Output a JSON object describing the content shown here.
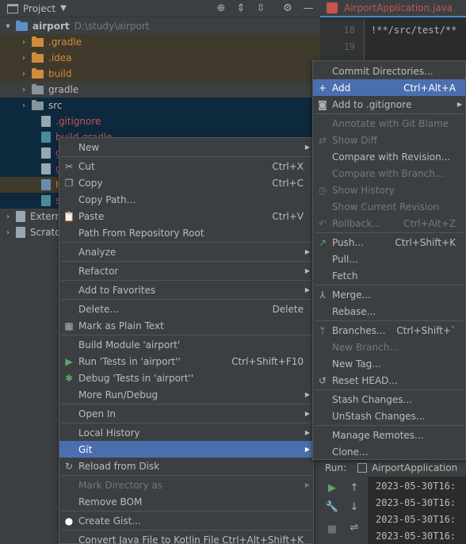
{
  "project": {
    "title": "Project",
    "tree": [
      {
        "label": "airport",
        "path": "D:\\study\\airport",
        "icon": "folder-blue-icon",
        "bold": true
      },
      {
        "label": ".gradle",
        "icon": "folder-orange-icon",
        "color": "#d18c3b"
      },
      {
        "label": ".idea",
        "icon": "folder-orange-icon",
        "color": "#d18c3b"
      },
      {
        "label": "build",
        "icon": "folder-orange-icon",
        "color": "#d18c3b"
      },
      {
        "label": "gradle",
        "icon": "folder-gray-icon",
        "color": "#bbbbbb"
      },
      {
        "label": "src",
        "icon": "folder-gray-icon",
        "color": "#bbbbbb"
      },
      {
        "label": ".gitignore",
        "icon": "gitignore-file-icon",
        "color": "#c75450"
      },
      {
        "label": "build.gradle",
        "icon": "gradle-file-icon",
        "color": "#c75450"
      },
      {
        "label": "gra",
        "icon": "terminal-file-icon",
        "color": "#c75450"
      },
      {
        "label": "gra",
        "icon": "text-file-icon",
        "color": "#c75450"
      },
      {
        "label": "HE",
        "icon": "markdown-file-icon",
        "color": "#d18c3b"
      },
      {
        "label": "set",
        "icon": "gradle-file-icon",
        "color": "#c75450"
      },
      {
        "label": "Extern",
        "icon": "library-icon",
        "color": "#bbbbbb"
      },
      {
        "label": "Scrato",
        "icon": "scratch-icon",
        "color": "#bbbbbb"
      }
    ]
  },
  "editor": {
    "tab_label": "AirportApplication.java",
    "lines": [
      {
        "no": "18",
        "text": "!**/src/test/**"
      },
      {
        "no": "19",
        "text": ""
      }
    ]
  },
  "run": {
    "title": "Run:",
    "tab": "AirportApplication",
    "log": [
      "2023-05-30T16:",
      "2023-05-30T16:",
      "2023-05-30T16:",
      "2023-05-30T16:"
    ]
  },
  "main_menu": {
    "items": [
      {
        "label": "New",
        "sub": true
      },
      {
        "sep": true
      },
      {
        "label": "Cut",
        "shortcut": "Ctrl+X",
        "icon": "cut-icon"
      },
      {
        "label": "Copy",
        "shortcut": "Ctrl+C",
        "icon": "copy-icon"
      },
      {
        "label": "Copy Path..."
      },
      {
        "label": "Paste",
        "shortcut": "Ctrl+V",
        "icon": "paste-icon"
      },
      {
        "label": "Path From Repository Root"
      },
      {
        "sep": true
      },
      {
        "label": "Analyze",
        "sub": true
      },
      {
        "sep": true
      },
      {
        "label": "Refactor",
        "sub": true
      },
      {
        "sep": true
      },
      {
        "label": "Add to Favorites",
        "sub": true
      },
      {
        "sep": true
      },
      {
        "label": "Delete...",
        "shortcut": "Delete"
      },
      {
        "label": "Mark as Plain Text",
        "icon": "plain-text-icon"
      },
      {
        "sep": true
      },
      {
        "label": "Build Module 'airport'"
      },
      {
        "label": "Run 'Tests in 'airport''",
        "shortcut": "Ctrl+Shift+F10",
        "icon": "run-icon"
      },
      {
        "label": "Debug 'Tests in 'airport''",
        "icon": "debug-icon"
      },
      {
        "label": "More Run/Debug",
        "sub": true
      },
      {
        "sep": true
      },
      {
        "label": "Open In",
        "sub": true
      },
      {
        "sep": true
      },
      {
        "label": "Local History",
        "sub": true
      },
      {
        "label": "Git",
        "sub": true,
        "highlighted": true
      },
      {
        "label": "Reload from Disk",
        "icon": "reload-icon"
      },
      {
        "sep": true
      },
      {
        "label": "Mark Directory as",
        "sub": true,
        "disabled": true
      },
      {
        "label": "Remove BOM"
      },
      {
        "sep": true
      },
      {
        "label": "Create Gist...",
        "icon": "github-icon"
      },
      {
        "sep": true
      },
      {
        "label": "Convert Java File to Kotlin File",
        "shortcut": "Ctrl+Alt+Shift+K"
      }
    ]
  },
  "git_menu": {
    "items": [
      {
        "label": "Commit Directories..."
      },
      {
        "label": "Add",
        "shortcut": "Ctrl+Alt+A",
        "icon": "plus-icon",
        "highlighted": true
      },
      {
        "label": "Add to .gitignore",
        "sub": true,
        "icon": "gitignore-icon"
      },
      {
        "sep": true
      },
      {
        "label": "Annotate with Git Blame",
        "disabled": true
      },
      {
        "label": "Show Diff",
        "disabled": true,
        "icon": "diff-icon"
      },
      {
        "label": "Compare with Revision..."
      },
      {
        "label": "Compare with Branch...",
        "disabled": true
      },
      {
        "label": "Show History",
        "disabled": true,
        "icon": "history-icon"
      },
      {
        "label": "Show Current Revision",
        "disabled": true
      },
      {
        "label": "Rollback...",
        "shortcut": "Ctrl+Alt+Z",
        "disabled": true,
        "icon": "rollback-icon"
      },
      {
        "sep": true
      },
      {
        "label": "Push...",
        "shortcut": "Ctrl+Shift+K",
        "icon": "push-icon"
      },
      {
        "label": "Pull..."
      },
      {
        "label": "Fetch"
      },
      {
        "sep": true
      },
      {
        "label": "Merge...",
        "icon": "merge-icon"
      },
      {
        "label": "Rebase..."
      },
      {
        "sep": true
      },
      {
        "label": "Branches...",
        "shortcut": "Ctrl+Shift+`",
        "icon": "branch-icon"
      },
      {
        "label": "New Branch...",
        "disabled": true
      },
      {
        "label": "New Tag..."
      },
      {
        "label": "Reset HEAD...",
        "icon": "reset-icon"
      },
      {
        "sep": true
      },
      {
        "label": "Stash Changes..."
      },
      {
        "label": "UnStash Changes..."
      },
      {
        "sep": true
      },
      {
        "label": "Manage Remotes..."
      },
      {
        "label": "Clone..."
      }
    ]
  }
}
